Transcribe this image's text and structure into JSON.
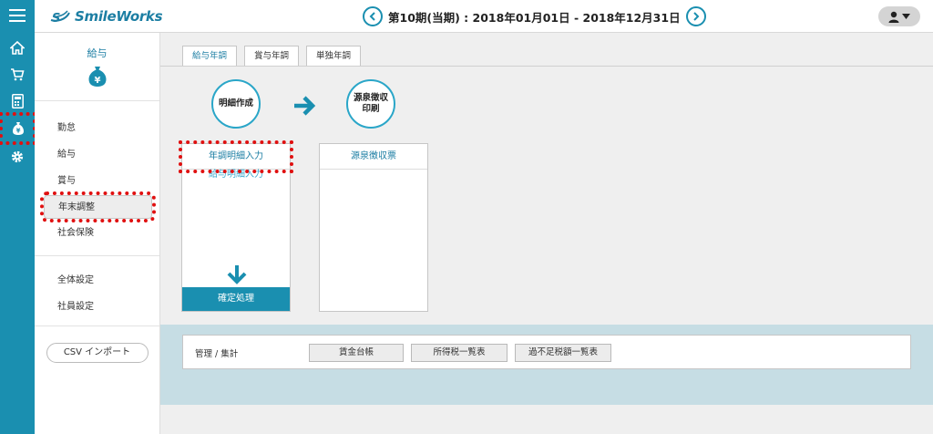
{
  "app": {
    "logo_text": "SmileWorks"
  },
  "header": {
    "period": "第10期(当期) : 2018年01月01日 - 2018年12月31日"
  },
  "iconbar": {
    "items": [
      {
        "icon": "menu-icon"
      },
      {
        "icon": "home-icon"
      },
      {
        "icon": "cart-icon"
      },
      {
        "icon": "calculator-icon"
      },
      {
        "icon": "payroll-icon"
      },
      {
        "icon": "gear-icon"
      }
    ],
    "highlight_color": "#e01010"
  },
  "sidebar": {
    "title": "給与",
    "group1": [
      "勤怠",
      "給与",
      "賞与",
      "年末調整",
      "社会保険"
    ],
    "group2": [
      "全体設定",
      "社員設定"
    ],
    "csv_button": "CSV インポート"
  },
  "tabs": [
    "給与年調",
    "賞与年調",
    "単独年調"
  ],
  "steps": {
    "step1": "明細作成",
    "step2_line1": "源泉徴収",
    "step2_line2": "印刷"
  },
  "panel1": {
    "row1": "年調明細入力",
    "row2": "給与明細入力",
    "confirm": "確定処理"
  },
  "panel2": {
    "row1": "源泉徴収票"
  },
  "management": {
    "label": "管理 / 集計",
    "buttons": [
      "賃金台帳",
      "所得税一覧表",
      "過不足税額一覧表"
    ]
  },
  "colors": {
    "accent": "#1a8fb0",
    "highlight": "#e01010",
    "lower_band": "#c6dde4"
  }
}
